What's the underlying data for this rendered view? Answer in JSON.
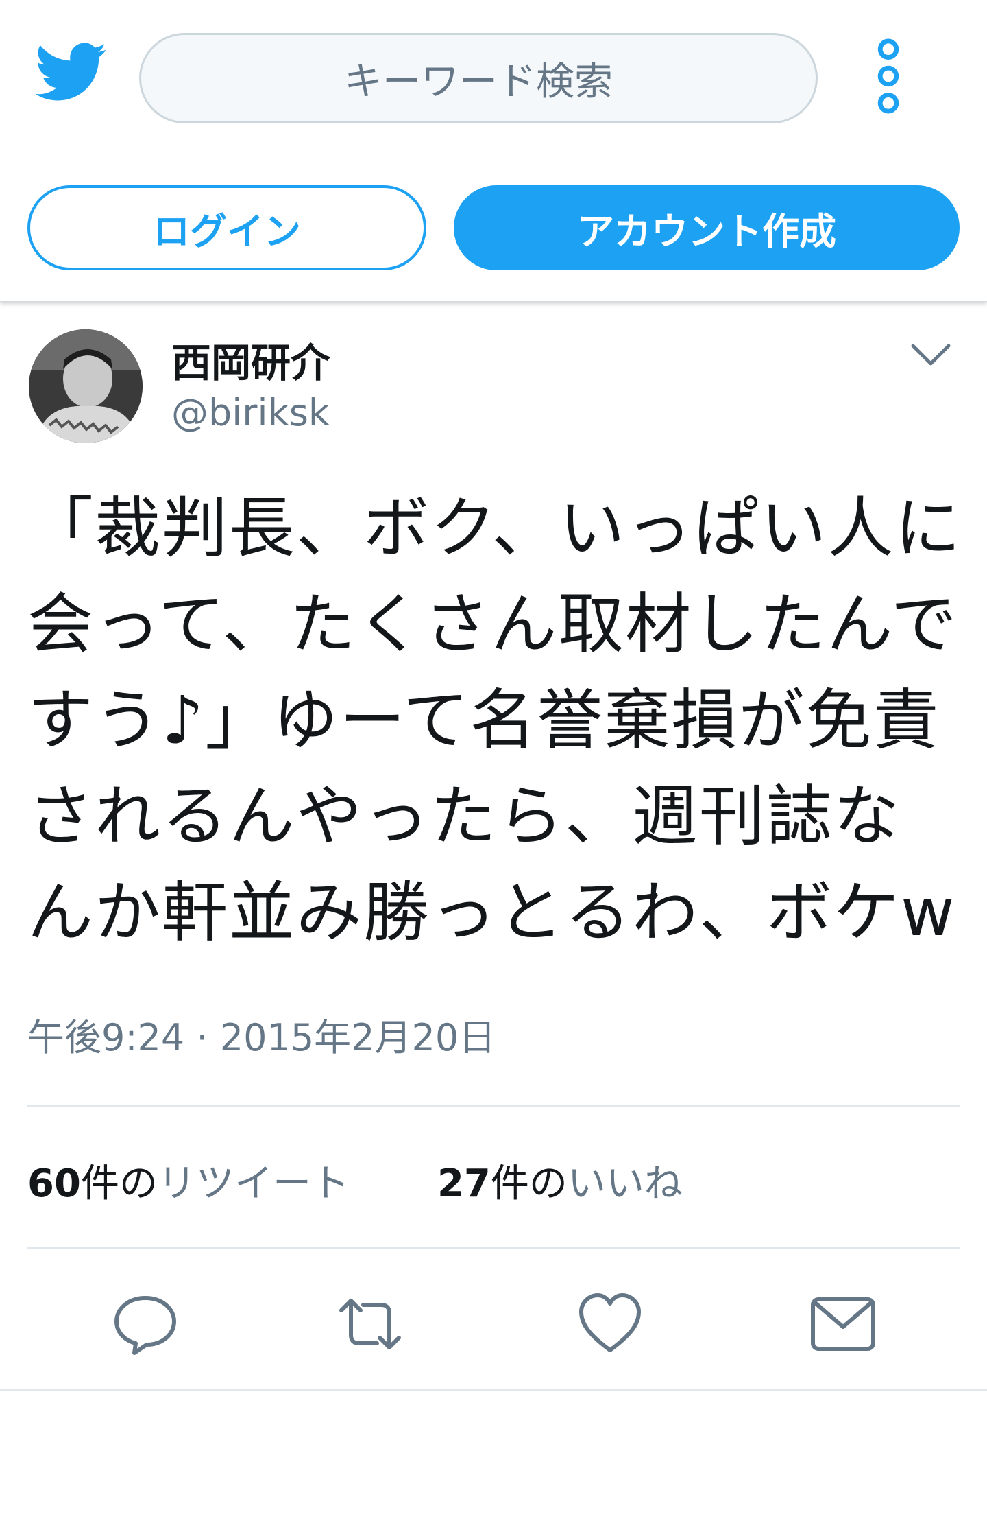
{
  "header": {
    "search_placeholder": "キーワード検索",
    "login_label": "ログイン",
    "signup_label": "アカウント作成",
    "logo_icon": "twitter-bird-icon",
    "more_icon": "more-vertical-icon"
  },
  "tweet": {
    "author_name": "西岡研介",
    "author_handle": "@biriksk",
    "text": "「裁判長、ボク、いっぱい人に会って、たくさん取材したんですう♪」ゆーて名誉棄損が免責されるんやったら、週刊誌なんか軒並み勝っとるわ、ボケw",
    "timestamp": "午後9:24 · 2015年2月20日",
    "retweets_count": "60",
    "retweets_unit": "件の",
    "retweets_label": "リツイート",
    "likes_count": "27",
    "likes_unit": "件の",
    "likes_label": "いいね"
  },
  "actions": [
    "reply-icon",
    "retweet-icon",
    "like-icon",
    "message-icon"
  ],
  "colors": {
    "accent": "#1da1f2",
    "secondary_text": "#657786",
    "icon": "#657786",
    "divider": "#e1e8ed"
  }
}
